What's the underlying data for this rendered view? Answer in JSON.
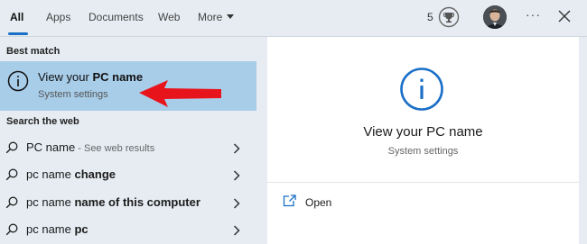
{
  "tabs": [
    {
      "label": "All"
    },
    {
      "label": "Apps"
    },
    {
      "label": "Documents"
    },
    {
      "label": "Web"
    },
    {
      "label": "More"
    }
  ],
  "header": {
    "points": "5",
    "ellipsis": "···"
  },
  "best_match": {
    "section_label": "Best match",
    "title_prefix": "View your ",
    "title_bold": "PC name",
    "subtitle": "System settings"
  },
  "web": {
    "section_label": "Search the web",
    "results": [
      {
        "normal": "PC name",
        "bold": "",
        "hint": " - See web results"
      },
      {
        "normal": "pc name ",
        "bold": "change",
        "hint": ""
      },
      {
        "normal": "pc name ",
        "bold": "name of this computer",
        "hint": ""
      },
      {
        "normal": "pc name ",
        "bold": "pc",
        "hint": ""
      }
    ]
  },
  "detail": {
    "title": "View your PC name",
    "subtitle": "System settings",
    "action_label": "Open"
  },
  "colors": {
    "accent": "#1a6fc7",
    "selected_bg": "#a8cde9",
    "pane_bg": "#e6ecf2",
    "annotation_arrow": "#e8141c"
  }
}
